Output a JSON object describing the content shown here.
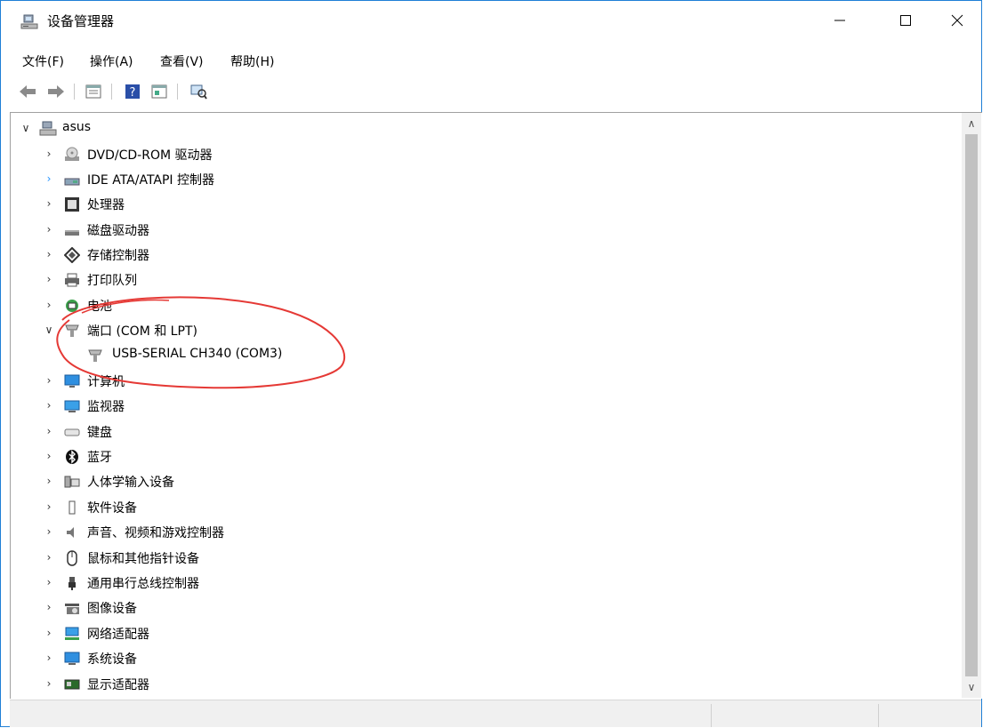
{
  "window": {
    "title": "设备管理器",
    "controls": {
      "minimize": "—",
      "maximize": "☐",
      "close": "✕"
    }
  },
  "menu": [
    "文件(F)",
    "操作(A)",
    "查看(V)",
    "帮助(H)"
  ],
  "toolbar": [
    "back-icon",
    "forward-icon",
    "properties-icon",
    "help-icon",
    "show-hidden-icon",
    "scan-hardware-icon"
  ],
  "tree": {
    "root": "asus",
    "categories": [
      {
        "label": "DVD/CD-ROM 驱动器",
        "icon": "dvd-icon"
      },
      {
        "label": "IDE ATA/ATAPI 控制器",
        "icon": "ide-icon"
      },
      {
        "label": "处理器",
        "icon": "cpu-icon"
      },
      {
        "label": "磁盘驱动器",
        "icon": "disk-icon"
      },
      {
        "label": "存储控制器",
        "icon": "storage-icon"
      },
      {
        "label": "打印队列",
        "icon": "printer-icon"
      },
      {
        "label": "电池",
        "icon": "battery-icon"
      },
      {
        "label": "端口 (COM 和 LPT)",
        "icon": "port-icon"
      },
      {
        "label": "USB-SERIAL CH340 (COM3)",
        "icon": "port-icon"
      },
      {
        "label": "计算机",
        "icon": "computer-icon"
      },
      {
        "label": "监视器",
        "icon": "monitor-icon"
      },
      {
        "label": "键盘",
        "icon": "keyboard-icon"
      },
      {
        "label": "蓝牙",
        "icon": "bluetooth-icon"
      },
      {
        "label": "人体学输入设备",
        "icon": "hid-icon"
      },
      {
        "label": "软件设备",
        "icon": "software-device-icon"
      },
      {
        "label": "声音、视频和游戏控制器",
        "icon": "sound-icon"
      },
      {
        "label": "鼠标和其他指针设备",
        "icon": "mouse-icon"
      },
      {
        "label": "通用串行总线控制器",
        "icon": "usb-icon"
      },
      {
        "label": "图像设备",
        "icon": "camera-icon"
      },
      {
        "label": "网络适配器",
        "icon": "network-icon"
      },
      {
        "label": "系统设备",
        "icon": "system-icon"
      },
      {
        "label": "显示适配器",
        "icon": "display-adapter-icon"
      }
    ]
  },
  "colors": {
    "accent": "#1f7fd6",
    "annotation": "#e53935",
    "chevron-accent": "#1e90ff"
  }
}
